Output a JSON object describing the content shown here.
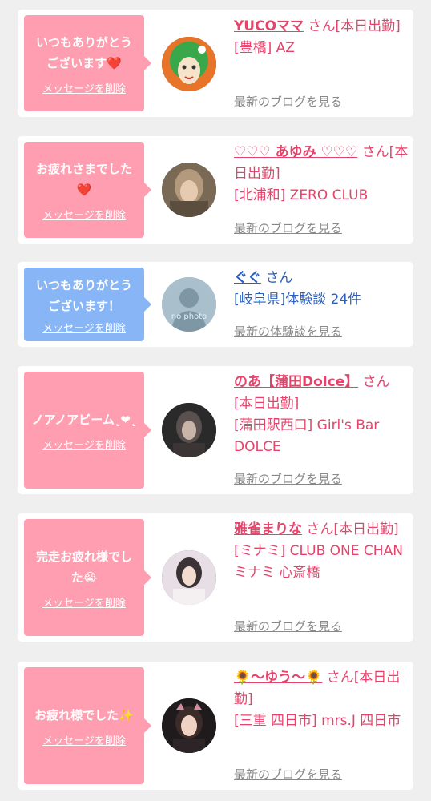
{
  "items": [
    {
      "message": "いつもありがとう\nございます❤️",
      "delete_label": "メッセージを削除",
      "name": "YUCOママ",
      "suffix": "さん[本日出勤]",
      "detail": "[豊橋] AZ",
      "more_label": "最新のブログを見る"
    },
    {
      "message": "お疲れさまでした\n❤️",
      "delete_label": "メッセージを削除",
      "name": "♡♡♡ あゆみ ♡♡♡",
      "suffix": "さん[本日出勤]",
      "detail": "[北浦和] ZERO CLUB",
      "more_label": "最新のブログを見る"
    },
    {
      "message": "いつもありがとう\nございます！",
      "delete_label": "メッセージを削除",
      "name": "ぐぐ",
      "suffix": "さん",
      "detail": "[岐阜県]体験談 24件",
      "more_label": "最新の体験談を見る",
      "avatar_text": "no photo"
    },
    {
      "message": "ノアノアビーム˛❤︎˛",
      "delete_label": "メッセージを削除",
      "name": "のあ【蒲田Dolce】",
      "suffix": "さん[本日出勤]",
      "detail": "[蒲田駅西口] Girl's Bar DOLCE",
      "more_label": "最新のブログを見る"
    },
    {
      "message": "完走お疲れ様でし\nた😭",
      "delete_label": "メッセージを削除",
      "name": "雅雀まりな",
      "suffix": "さん[本日出勤]",
      "detail": "[ミナミ] CLUB ONE CHAN ミナミ 心斎橋",
      "more_label": "最新のブログを見る"
    },
    {
      "message": "お疲れ様でした✨",
      "delete_label": "メッセージを削除",
      "name": "🌻〜ゆう〜🌻",
      "suffix": "さん[本日出勤]",
      "detail": "[三重 四日市] mrs.J 四日市",
      "more_label": "最新のブログを見る"
    }
  ]
}
